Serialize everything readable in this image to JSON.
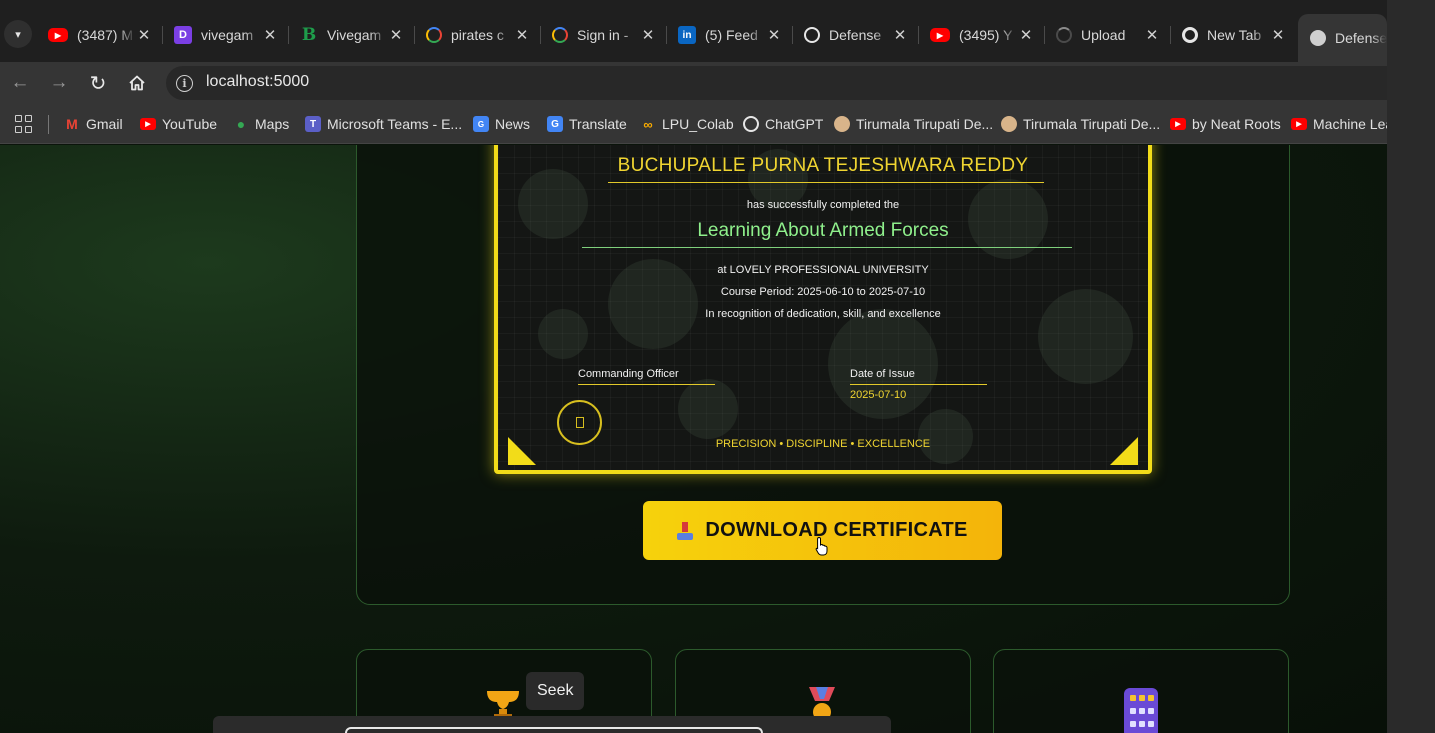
{
  "tabs": [
    {
      "title": "(3487) M",
      "icon": "youtube-icon",
      "color": "#ff0000"
    },
    {
      "title": "vivegam",
      "icon": "letter-d-icon",
      "color": "#7b3fe4"
    },
    {
      "title": "Vivegam",
      "icon": "letter-b-icon",
      "color": "#1e9d4b"
    },
    {
      "title": "pirates c",
      "icon": "google-icon",
      "color": "#ffffff"
    },
    {
      "title": "Sign in -",
      "icon": "google-icon",
      "color": "#ffffff"
    },
    {
      "title": "(5) Feed",
      "icon": "linkedin-icon",
      "color": "#0a66c2"
    },
    {
      "title": "Defense",
      "icon": "openai-icon",
      "color": "#ffffff"
    },
    {
      "title": "(3495) Y",
      "icon": "youtube-icon",
      "color": "#ff0000"
    },
    {
      "title": "Upload",
      "icon": "loading-icon",
      "color": "#5a5a5a"
    },
    {
      "title": "New Tab",
      "icon": "chrome-icon",
      "color": "#ffffff"
    },
    {
      "title": "Defense",
      "icon": "globe-icon",
      "color": "#cfcfcf"
    }
  ],
  "address": {
    "url": "localhost:5000"
  },
  "bookmarks": [
    {
      "label": "Gmail",
      "icon": "gmail-icon",
      "color": "#ea4335"
    },
    {
      "label": "YouTube",
      "icon": "youtube-icon",
      "color": "#ff0000"
    },
    {
      "label": "Maps",
      "icon": "maps-icon",
      "color": "#34a853"
    },
    {
      "label": "Microsoft Teams - E...",
      "icon": "teams-icon",
      "color": "#5b5fc7"
    },
    {
      "label": "News",
      "icon": "news-icon",
      "color": "#4285f4"
    },
    {
      "label": "Translate",
      "icon": "translate-icon",
      "color": "#4285f4"
    },
    {
      "label": "LPU_Colab",
      "icon": "colab-icon",
      "color": "#f9ab00"
    },
    {
      "label": "ChatGPT",
      "icon": "openai-icon",
      "color": "#ffffff"
    },
    {
      "label": "Tirumala Tirupati De...",
      "icon": "temple-icon",
      "color": "#d8b48a"
    },
    {
      "label": "Tirumala Tirupati De...",
      "icon": "temple-icon",
      "color": "#d8b48a"
    },
    {
      "label": "by Neat Roots",
      "icon": "youtube-icon",
      "color": "#ff0000"
    },
    {
      "label": "Machine Lea",
      "icon": "youtube-icon",
      "color": "#ff0000"
    }
  ],
  "certificate": {
    "name": "BUCHUPALLE PURNA TEJESHWARA REDDY",
    "completed_text": "has successfully completed the",
    "course": "Learning About Armed Forces",
    "institution": "at LOVELY PROFESSIONAL UNIVERSITY",
    "period": "Course Period: 2025-06-10 to 2025-07-10",
    "recognition": "In recognition of dedication, skill, and excellence",
    "signatory_label": "Commanding Officer",
    "issue_label": "Date of Issue",
    "issue_date": "2025-07-10",
    "motto": "PRECISION • DISCIPLINE • EXCELLENCE"
  },
  "download_button": {
    "label": "DOWNLOAD CERTIFICATE"
  },
  "tooltip": {
    "label": "Seek"
  },
  "colors": {
    "accent": "#f2dc19",
    "course_green": "#8ff08c",
    "panel_border": "#2c5a2c"
  }
}
